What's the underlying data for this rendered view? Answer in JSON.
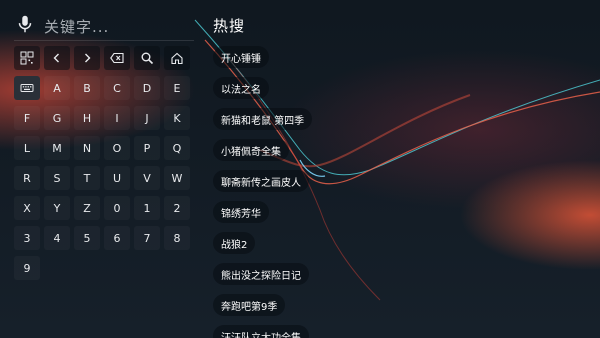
{
  "search": {
    "placeholder": "关键字...",
    "mic_icon": "microphone-icon"
  },
  "keyboard": {
    "function_row": [
      {
        "name": "qr-code-icon",
        "label": ""
      },
      {
        "name": "chevron-left-icon",
        "label": ""
      },
      {
        "name": "chevron-right-icon",
        "label": ""
      },
      {
        "name": "backspace-icon",
        "label": ""
      },
      {
        "name": "search-icon",
        "label": ""
      },
      {
        "name": "home-icon",
        "label": ""
      }
    ],
    "row1": [
      "",
      "A",
      "B",
      "C",
      "D",
      "E"
    ],
    "row2": [
      "F",
      "G",
      "H",
      "I",
      "J",
      "K"
    ],
    "row3": [
      "L",
      "M",
      "N",
      "O",
      "P",
      "Q"
    ],
    "row4": [
      "R",
      "S",
      "T",
      "U",
      "V",
      "W"
    ],
    "row5": [
      "X",
      "Y",
      "Z",
      "0",
      "1",
      "2"
    ],
    "row6": [
      "3",
      "4",
      "5",
      "6",
      "7",
      "8"
    ],
    "row7": [
      "9"
    ],
    "keyboard_toggle_icon": "keyboard-icon"
  },
  "hot": {
    "title": "热搜",
    "items": [
      "开心锤锤",
      "以法之名",
      "新猫和老鼠 第四季",
      "小猪佩奇全集",
      "聊斋新传之画皮人",
      "锦绣芳华",
      "战狼2",
      "熊出没之探险日记",
      "奔跑吧第9季",
      "汪汪队立大功全集"
    ]
  },
  "colors": {
    "background": "#131c25",
    "accent_red": "#d8503a",
    "wave_cyan": "#4fd1d9",
    "text": "#ffffff",
    "placeholder": "#a8adb3"
  }
}
